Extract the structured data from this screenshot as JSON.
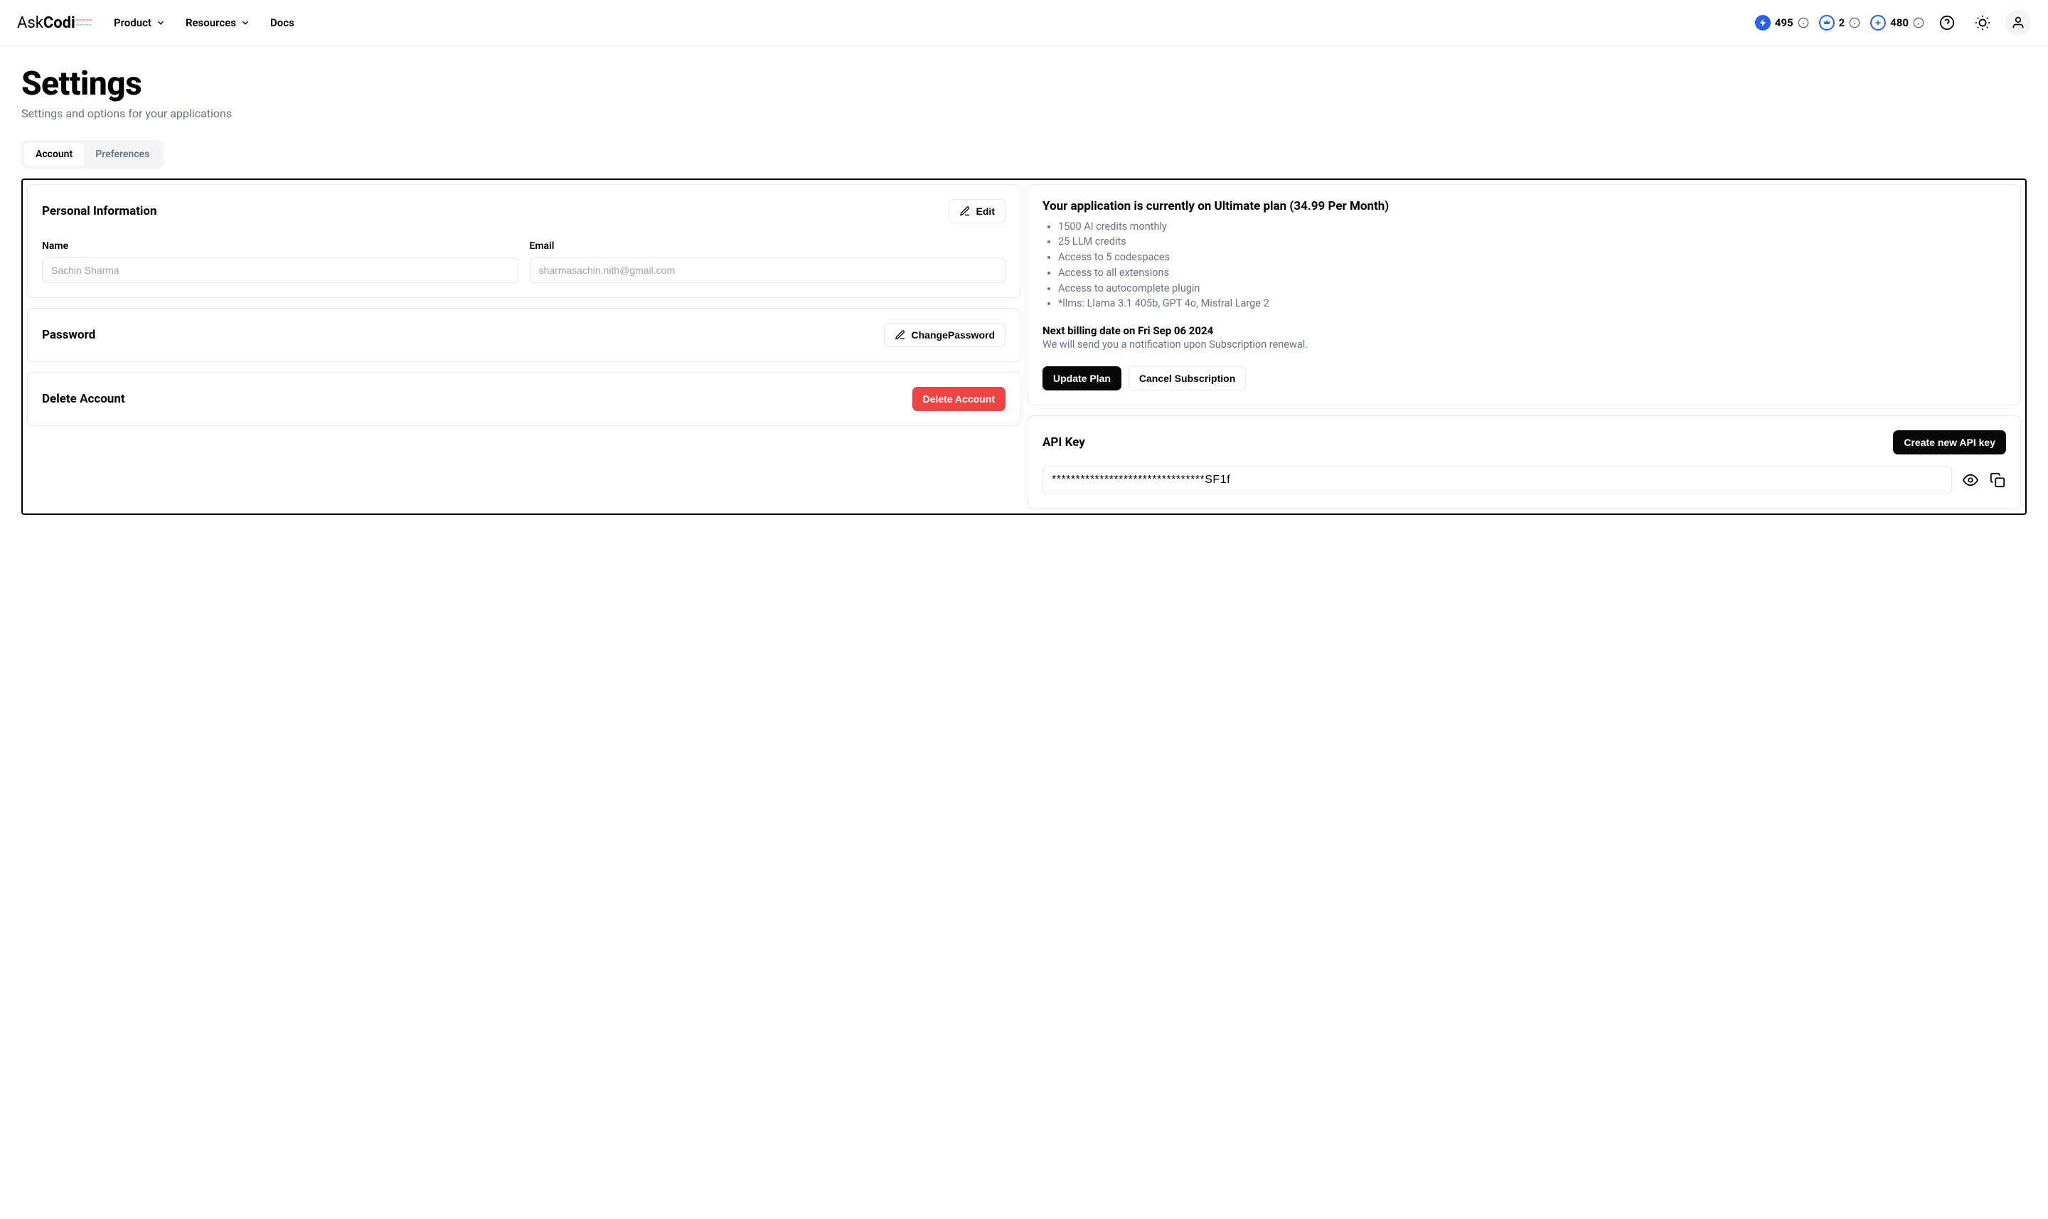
{
  "logo": {
    "part1": "Ask",
    "part2": "Codi"
  },
  "nav": {
    "product": "Product",
    "resources": "Resources",
    "docs": "Docs"
  },
  "header_stats": {
    "credits": "495",
    "crown": "2",
    "add": "480"
  },
  "page": {
    "title": "Settings",
    "subtitle": "Settings and options for your applications"
  },
  "tabs": {
    "account": "Account",
    "preferences": "Preferences"
  },
  "personal_info": {
    "title": "Personal Information",
    "edit_button": "Edit",
    "name_label": "Name",
    "name_value": "Sachin Sharma",
    "email_label": "Email",
    "email_value": "sharmasachin.nith@gmail.com"
  },
  "password": {
    "title": "Password",
    "change_button": "ChangePassword"
  },
  "delete_account": {
    "title": "Delete Account",
    "button": "Delete Account"
  },
  "plan": {
    "title": "Your application is currently on Ultimate plan (34.99 Per Month)",
    "features": [
      "1500 AI credits monthly",
      "25 LLM credits",
      "Access to 5 codespaces",
      "Access to all extensions",
      "Access to autocomplete plugin",
      "*llms: Llama 3.1 405b, GPT 4o, Mistral Large 2"
    ],
    "billing_date": "Next billing date on Fri Sep 06 2024",
    "billing_note": "We will send you a notification upon Subscription renewal.",
    "update_button": "Update Plan",
    "cancel_button": "Cancel Subscription"
  },
  "api_key": {
    "title": "API Key",
    "create_button": "Create new API key",
    "value": "********************************SF1f"
  }
}
